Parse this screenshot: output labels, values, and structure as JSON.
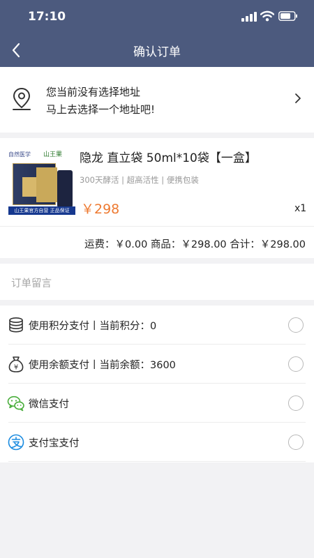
{
  "status_bar": {
    "time": "17:10"
  },
  "header": {
    "title": "确认订单"
  },
  "address": {
    "line1": "您当前没有选择地址",
    "line2": "马上去选择一个地址吧!"
  },
  "product": {
    "title": "隐龙 直立袋 50ml*10袋【一盒】",
    "tags": "300天酵活 | 超高活性 | 便携包装",
    "price": "￥298",
    "quantity": "x1",
    "thumb_header": "自然医学",
    "thumb_brand": "山王果",
    "thumb_footer": "山王果官方自营 正品保证"
  },
  "summary": {
    "text": "运费：￥0.00 商品：￥298.00 合计：￥298.00"
  },
  "remark": {
    "label": "订单留言"
  },
  "payment_options": [
    {
      "label": "使用积分支付丨当前积分：0",
      "icon": "coins-icon",
      "selected": false
    },
    {
      "label": "使用余额支付丨当前余额：3600",
      "icon": "money-bag-icon",
      "selected": false
    },
    {
      "label": "微信支付",
      "icon": "wechat-icon",
      "selected": false
    },
    {
      "label": "支付宝支付",
      "icon": "alipay-icon",
      "selected": false
    }
  ],
  "colors": {
    "header_bg": "#4c5a7e",
    "price": "#ee7a31",
    "page_bg": "#f2f2f4"
  }
}
